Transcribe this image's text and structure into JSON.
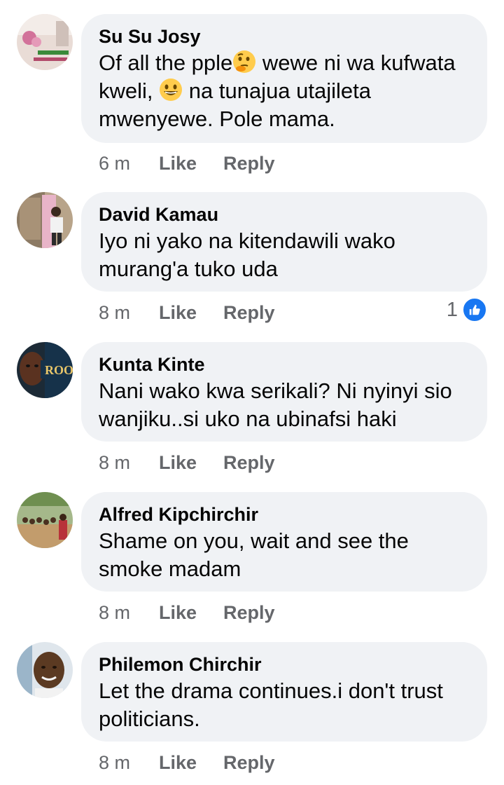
{
  "comments": [
    {
      "author": "Su Su Josy",
      "text_part1": "Of all the pple",
      "text_part2": " wewe ni wa kufwata kweli, ",
      "text_part3": " na tunajua utajileta mwenyewe.  Pole mama.",
      "emojis": [
        "thinking-face-emoji",
        "grinning-face-emoji"
      ],
      "time": "6 m",
      "like_label": "Like",
      "reply_label": "Reply"
    },
    {
      "author": "David Kamau",
      "text": "Iyo ni yako na kitendawili wako murang'a tuko uda",
      "time": "8 m",
      "like_label": "Like",
      "reply_label": "Reply",
      "reactions": {
        "count": "1",
        "icon": "thumbs-up-icon"
      }
    },
    {
      "author": "Kunta Kinte",
      "text": "Nani wako kwa serikali? Ni nyinyi sio wanjiku..si uko na ubinafsi haki",
      "time": "8 m",
      "like_label": "Like",
      "reply_label": "Reply",
      "avatar_text": "ROOT"
    },
    {
      "author": "Alfred Kipchirchir",
      "text": "Shame on you, wait and see the smoke madam",
      "time": "8 m",
      "like_label": "Like",
      "reply_label": "Reply"
    },
    {
      "author": "Philemon Chirchir",
      "text": "Let the drama continues.i don't trust politicians.",
      "time": "8 m",
      "like_label": "Like",
      "reply_label": "Reply"
    }
  ],
  "colors": {
    "bubble_bg": "#f0f2f5",
    "meta_text": "#65676b",
    "like_blue": "#1877f2"
  }
}
